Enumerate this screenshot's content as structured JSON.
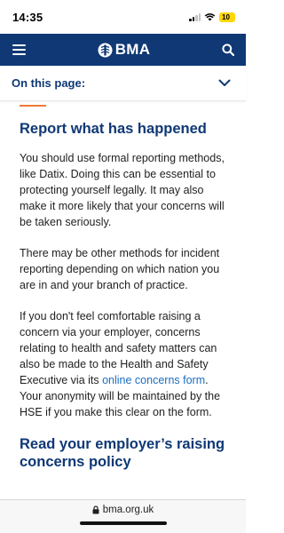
{
  "status_bar": {
    "time": "14:35",
    "battery": "10"
  },
  "header": {
    "logo_text": "BMA"
  },
  "on_this_page": {
    "label": "On this page:"
  },
  "section1": {
    "heading": "Report what has happened",
    "para1": "You should use formal reporting methods, like Datix. Doing this can be essential to protecting yourself legally. It may also make it more likely that your concerns will be taken seriously.",
    "para2": "There may be other methods for incident reporting depending on which nation you are in and your branch of practice.",
    "para3_before": "If you don't feel comfortable raising a concern via your employer, concerns relating to health and safety matters can also be made to the Health and Safety Executive via its ",
    "para3_link": "online concerns form",
    "para3_after": ". Your anonymity will be maintained by the HSE if you make this clear on the form."
  },
  "section2": {
    "heading": "Read your employer’s raising concerns policy"
  },
  "browser": {
    "url": "bma.org.uk"
  },
  "colors": {
    "brand_navy": "#0f3875",
    "accent_orange": "#f07a36",
    "link_blue": "#1b6ec2",
    "battery_yellow": "#ffd60a"
  }
}
